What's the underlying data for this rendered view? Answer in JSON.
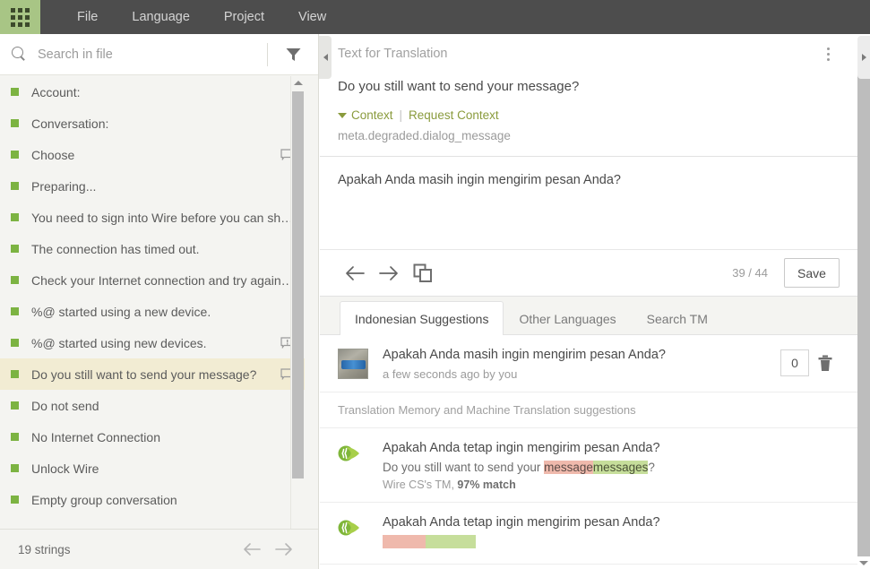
{
  "topbar": {
    "apps_icon": "grid-apps-icon",
    "menu": [
      {
        "label": "File"
      },
      {
        "label": "Language"
      },
      {
        "label": "Project"
      },
      {
        "label": "View"
      }
    ]
  },
  "sidebar": {
    "search": {
      "placeholder": "Search in file",
      "value": "",
      "icon": "search-icon"
    },
    "filter_icon": "funnel-filter-icon",
    "strings": [
      {
        "label": "Account:",
        "status_color": "#7cb342",
        "comment": null
      },
      {
        "label": "Conversation:",
        "status_color": "#7cb342",
        "comment": null
      },
      {
        "label": "Choose",
        "status_color": "#7cb342",
        "comment": "comment"
      },
      {
        "label": "Preparing...",
        "status_color": "#7cb342",
        "comment": null
      },
      {
        "label": "You need to sign into Wire before you can sha...",
        "status_color": "#7cb342",
        "comment": null
      },
      {
        "label": "The connection has timed out.",
        "status_color": "#7cb342",
        "comment": null
      },
      {
        "label": "Check your Internet connection and try again. ...",
        "status_color": "#7cb342",
        "comment": null
      },
      {
        "label": "%@ started using a new device.",
        "status_color": "#7cb342",
        "comment": null
      },
      {
        "label": "%@ started using new devices.",
        "status_color": "#7cb342",
        "comment": "issue"
      },
      {
        "label": "Do you still want to send your message?",
        "status_color": "#7cb342",
        "comment": "comment",
        "selected": true
      },
      {
        "label": "Do not send",
        "status_color": "#7cb342",
        "comment": null
      },
      {
        "label": "No Internet Connection",
        "status_color": "#7cb342",
        "comment": null
      },
      {
        "label": "Unlock Wire",
        "status_color": "#7cb342",
        "comment": null
      },
      {
        "label": "Empty group conversation",
        "status_color": "#7cb342",
        "comment": null
      }
    ],
    "footer": {
      "count_label": "19 strings",
      "prev_icon": "arrow-left-icon",
      "next_icon": "arrow-right-icon"
    }
  },
  "editor": {
    "source_header": "Text for Translation",
    "menu_icon": "kebab-menu-icon",
    "source_text": "Do you still want to send your message?",
    "context_label": "Context",
    "context_separator": "|",
    "request_context_label": "Request Context",
    "context_key": "meta.degraded.dialog_message",
    "translation_value": "Apakah Anda masih ingin mengirim pesan Anda?",
    "toolbar": {
      "prev_icon": "arrow-left-icon",
      "next_icon": "arrow-right-icon",
      "copy_source_icon": "copy-source-icon",
      "progress": "39 / 44",
      "save_label": "Save"
    }
  },
  "tabs": [
    {
      "label": "Indonesian Suggestions",
      "active": true
    },
    {
      "label": "Other Languages",
      "active": false
    },
    {
      "label": "Search TM",
      "active": false
    }
  ],
  "suggestions": {
    "user_entry": {
      "avatar": "user-avatar",
      "target": "Apakah Anda masih ingin mengirim pesan Anda?",
      "meta": "a few seconds ago by you",
      "score": "0",
      "delete_icon": "trash-icon"
    },
    "tm_note": "Translation Memory and Machine Translation suggestions",
    "tm_entries": [
      {
        "icon": "tm-leaf-icon",
        "target": "Apakah Anda tetap ingin mengirim pesan Anda?",
        "source_prefix": "Do you still want to send your ",
        "source_deleted": "message",
        "source_inserted": "messages",
        "source_suffix": "?",
        "origin_name": "Wire CS's TM,",
        "origin_match": "97% match"
      },
      {
        "icon": "tm-leaf-icon",
        "target": "Apakah Anda tetap ingin mengirim pesan Anda?",
        "source_prefix": "",
        "source_deleted": "",
        "source_inserted": "",
        "source_suffix": "",
        "origin_name": "",
        "origin_match": ""
      }
    ]
  },
  "panels": {
    "collapse_left_icon": "chevron-left-icon",
    "collapse_right_icon": "chevron-right-icon"
  },
  "colors": {
    "topbar_bg": "#4d4d4d",
    "apps_bg": "#a8c585",
    "accent_green": "#8a9b3d",
    "status_green": "#7cb342",
    "selected_row": "#f2ecd3",
    "diff_delete": "#efb9ac",
    "diff_insert": "#c6de9b"
  }
}
